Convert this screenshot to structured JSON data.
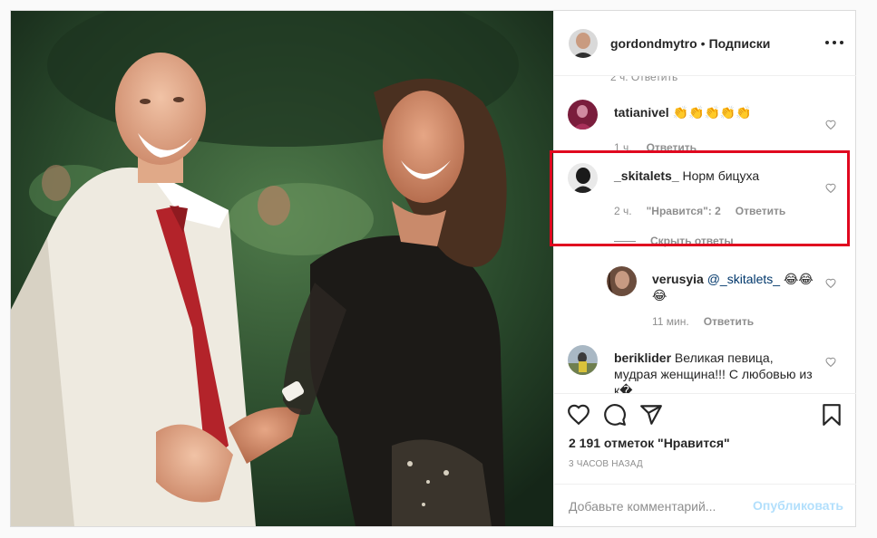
{
  "header": {
    "username": "gordondmytro",
    "separator": "•",
    "follow_label": "Подписки"
  },
  "comments": [
    {
      "username": "tatianivel",
      "text": "👏👏👏👏👏",
      "time": "1 ч.",
      "reply_label": "Ответить"
    },
    {
      "username": "_skitalets_",
      "text": "Норм бицуха",
      "time": "2 ч.",
      "likes": "\"Нравится\": 2",
      "reply_label": "Ответить",
      "hide_replies_label": "Скрыть ответы"
    },
    {
      "username": "verusyia",
      "mention": "@_skitalets_",
      "text": "😂😂😂",
      "time": "11 мин.",
      "reply_label": "Ответить"
    },
    {
      "username": "beriklider",
      "text": "Великая певица, мудрая женщина!!! С любовью из к�"
    }
  ],
  "actions": {
    "icons": [
      "heart-icon",
      "comment-icon",
      "share-icon",
      "bookmark-icon"
    ],
    "likes_text": "2 191 отметок \"Нравится\"",
    "time_ago": "3 ЧАСОВ НАЗАД"
  },
  "add_comment": {
    "placeholder": "Добавьте комментарий...",
    "publish_label": "Опубликовать"
  },
  "colors": {
    "highlight": "#e0081f",
    "publish_disabled": "#b2dffc",
    "mention": "#00376b"
  }
}
